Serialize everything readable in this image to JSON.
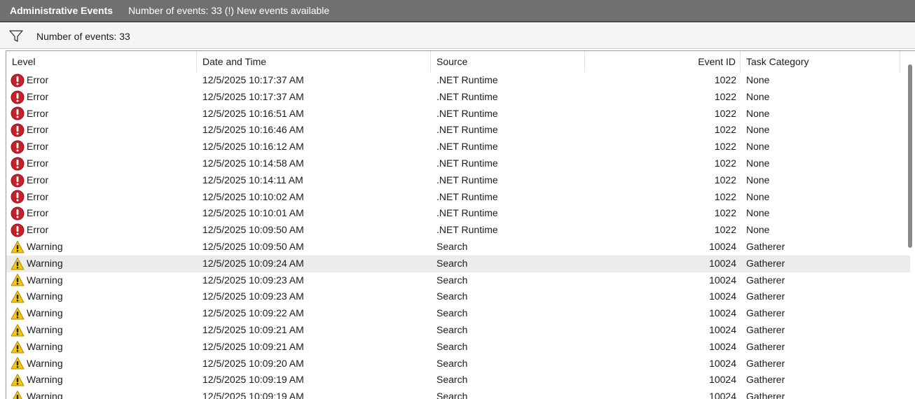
{
  "window": {
    "title": "Administrative Events",
    "subtitle": "Number of events: 33 (!) New events available"
  },
  "filter": {
    "icon": "filter-icon",
    "count_label": "Number of events: 33"
  },
  "columns": {
    "level": "Level",
    "date": "Date and Time",
    "source": "Source",
    "event_id": "Event ID",
    "category": "Task Category"
  },
  "colors": {
    "error": "#c8202b",
    "warning": "#f3c614",
    "selected_row": "#ececec",
    "titlebar": "#707070"
  },
  "rows": [
    {
      "level": "Error",
      "icon": "error-icon",
      "date": "12/5/2025 10:17:37 AM",
      "source": ".NET Runtime",
      "event_id": "1022",
      "category": "None"
    },
    {
      "level": "Error",
      "icon": "error-icon",
      "date": "12/5/2025 10:17:37 AM",
      "source": ".NET Runtime",
      "event_id": "1022",
      "category": "None"
    },
    {
      "level": "Error",
      "icon": "error-icon",
      "date": "12/5/2025 10:16:51 AM",
      "source": ".NET Runtime",
      "event_id": "1022",
      "category": "None"
    },
    {
      "level": "Error",
      "icon": "error-icon",
      "date": "12/5/2025 10:16:46 AM",
      "source": ".NET Runtime",
      "event_id": "1022",
      "category": "None"
    },
    {
      "level": "Error",
      "icon": "error-icon",
      "date": "12/5/2025 10:16:12 AM",
      "source": ".NET Runtime",
      "event_id": "1022",
      "category": "None"
    },
    {
      "level": "Error",
      "icon": "error-icon",
      "date": "12/5/2025 10:14:58 AM",
      "source": ".NET Runtime",
      "event_id": "1022",
      "category": "None"
    },
    {
      "level": "Error",
      "icon": "error-icon",
      "date": "12/5/2025 10:14:11 AM",
      "source": ".NET Runtime",
      "event_id": "1022",
      "category": "None"
    },
    {
      "level": "Error",
      "icon": "error-icon",
      "date": "12/5/2025 10:10:02 AM",
      "source": ".NET Runtime",
      "event_id": "1022",
      "category": "None"
    },
    {
      "level": "Error",
      "icon": "error-icon",
      "date": "12/5/2025 10:10:01 AM",
      "source": ".NET Runtime",
      "event_id": "1022",
      "category": "None"
    },
    {
      "level": "Error",
      "icon": "error-icon",
      "date": "12/5/2025 10:09:50 AM",
      "source": ".NET Runtime",
      "event_id": "1022",
      "category": "None"
    },
    {
      "level": "Warning",
      "icon": "warning-icon",
      "date": "12/5/2025 10:09:50 AM",
      "source": "Search",
      "event_id": "10024",
      "category": "Gatherer"
    },
    {
      "level": "Warning",
      "icon": "warning-icon",
      "date": "12/5/2025 10:09:24 AM",
      "source": "Search",
      "event_id": "10024",
      "category": "Gatherer",
      "selected": true
    },
    {
      "level": "Warning",
      "icon": "warning-icon",
      "date": "12/5/2025 10:09:23 AM",
      "source": "Search",
      "event_id": "10024",
      "category": "Gatherer"
    },
    {
      "level": "Warning",
      "icon": "warning-icon",
      "date": "12/5/2025 10:09:23 AM",
      "source": "Search",
      "event_id": "10024",
      "category": "Gatherer"
    },
    {
      "level": "Warning",
      "icon": "warning-icon",
      "date": "12/5/2025 10:09:22 AM",
      "source": "Search",
      "event_id": "10024",
      "category": "Gatherer"
    },
    {
      "level": "Warning",
      "icon": "warning-icon",
      "date": "12/5/2025 10:09:21 AM",
      "source": "Search",
      "event_id": "10024",
      "category": "Gatherer"
    },
    {
      "level": "Warning",
      "icon": "warning-icon",
      "date": "12/5/2025 10:09:21 AM",
      "source": "Search",
      "event_id": "10024",
      "category": "Gatherer"
    },
    {
      "level": "Warning",
      "icon": "warning-icon",
      "date": "12/5/2025 10:09:20 AM",
      "source": "Search",
      "event_id": "10024",
      "category": "Gatherer"
    },
    {
      "level": "Warning",
      "icon": "warning-icon",
      "date": "12/5/2025 10:09:19 AM",
      "source": "Search",
      "event_id": "10024",
      "category": "Gatherer"
    },
    {
      "level": "Warning",
      "icon": "warning-icon",
      "date": "12/5/2025 10:09:19 AM",
      "source": "Search",
      "event_id": "10024",
      "category": "Gatherer"
    }
  ]
}
